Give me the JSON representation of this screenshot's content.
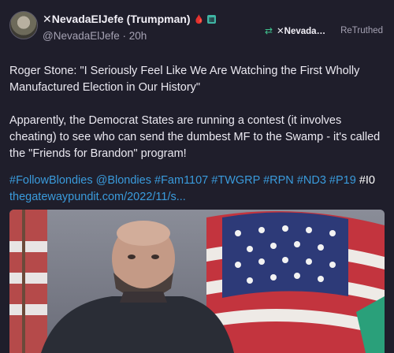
{
  "post": {
    "author_name": "✕NevadaElJefe (Trumpman)",
    "handle": "@NevadaElJefe",
    "time": "20h",
    "retruth_by": "✕Nevada…",
    "retruth_label": "ReTruthed",
    "paragraph1": "Roger Stone: \"I Seriously Feel Like We Are Watching the First Wholly Manufactured Election in Our History\"",
    "paragraph2": "Apparently, the Democrat States are running a contest (it involves cheating) to see who can send the dumbest MF to the Swamp - it's called the \"Friends for Brandon\" program!",
    "hashtags": [
      "#FollowBlondies",
      "@Blondies",
      "#Fam1107",
      "#TWGRP",
      "#RPN",
      "#ND3",
      "#P19"
    ],
    "hashtag_last": "#I0",
    "link": "thegatewaypundit.com/2022/11/s..."
  },
  "icons": {
    "drop": "blood-drop-icon",
    "badge": "badge-icon",
    "retruth": "retruth-icon"
  },
  "colors": {
    "background": "#1f1e2b",
    "link": "#3a9bdc",
    "retruth": "#3fc08c"
  }
}
